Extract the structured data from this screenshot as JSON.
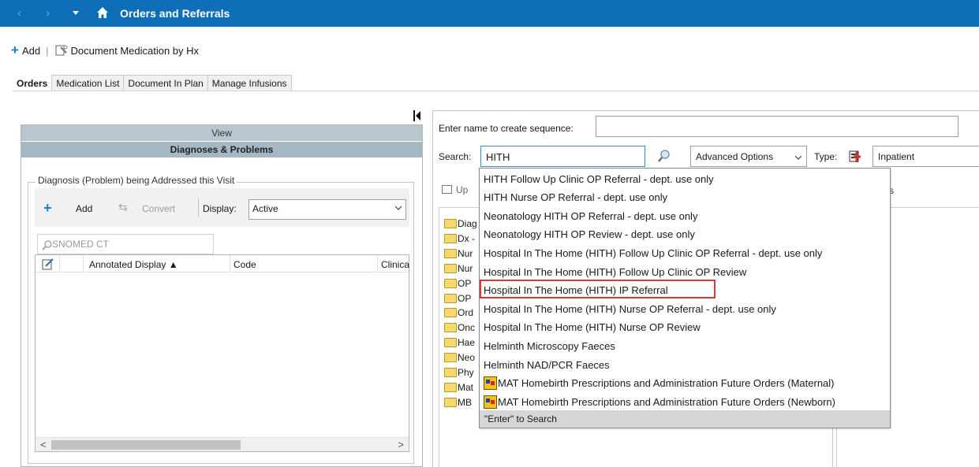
{
  "titlebar": {
    "title": "Orders and Referrals",
    "back_icon": "‹",
    "forward_icon": "›"
  },
  "toolbar": {
    "add_label": "Add",
    "separator": "|",
    "document_label": "Document Medication by Hx"
  },
  "tabs": [
    "Orders",
    "Medication List",
    "Document In Plan",
    "Manage Infusions"
  ],
  "left": {
    "view_header": "View",
    "section_header": "Diagnoses & Problems",
    "group_label": "Diagnosis (Problem) being Addressed this Visit",
    "add_label": "Add",
    "convert_label": "Convert",
    "display_label": "Display:",
    "display_value": "Active",
    "snomed_placeholder": "SNOMED CT",
    "columns": [
      "Annotated Display ▲",
      "Code",
      "Clinica"
    ],
    "scroll_left": "<",
    "scroll_right": ">"
  },
  "right": {
    "sequence_label": "Enter name to create sequence:",
    "search_label": "Search:",
    "search_value": "HITH",
    "advanced_label": "Advanced Options",
    "type_label": "Type:",
    "type_value": "Inpatient",
    "up_label": "Up",
    "right_fragment": "s",
    "folders": [
      "Diag",
      "Dx -",
      "Nur",
      "Nur",
      "OP",
      "OP",
      "Ord",
      "Onc",
      "Hae",
      "Neo",
      "Phy",
      "Mat",
      "MB"
    ]
  },
  "dropdown": {
    "items": [
      {
        "label": "HITH Follow Up Clinic OP Referral - dept. use only",
        "icon": ""
      },
      {
        "label": "HITH Nurse OP Referral - dept. use only",
        "icon": ""
      },
      {
        "label": "Neonatology HITH OP Referral - dept. use only",
        "icon": ""
      },
      {
        "label": "Neonatology HITH OP Review - dept. use only",
        "icon": ""
      },
      {
        "label": "Hospital In The Home (HITH) Follow Up Clinic OP Referral - dept. use only",
        "icon": ""
      },
      {
        "label": "Hospital In The Home (HITH) Follow Up Clinic OP Review",
        "icon": ""
      },
      {
        "label": "Hospital In The Home (HITH) IP Referral",
        "icon": "",
        "highlighted": true
      },
      {
        "label": "Hospital In The Home (HITH) Nurse OP Referral - dept. use only",
        "icon": ""
      },
      {
        "label": "Hospital In The Home (HITH) Nurse OP Review",
        "icon": ""
      },
      {
        "label": "Helminth Microscopy Faeces",
        "icon": ""
      },
      {
        "label": "Helminth NAD/PCR Faeces",
        "icon": ""
      },
      {
        "label": "MAT Homebirth Prescriptions and Administration Future Orders (Maternal)",
        "icon": "careset-icon"
      },
      {
        "label": "MAT Homebirth Prescriptions and Administration Future Orders (Newborn)",
        "icon": "careset-icon"
      }
    ],
    "enter_hint": "\"Enter\" to Search"
  },
  "colors": {
    "titlebar": "#0e6eb8",
    "accent_blue": "#1b7ad3",
    "highlight_red": "#e0353a",
    "view_header": "#b8c6cf",
    "section_header": "#a6b8c4"
  }
}
